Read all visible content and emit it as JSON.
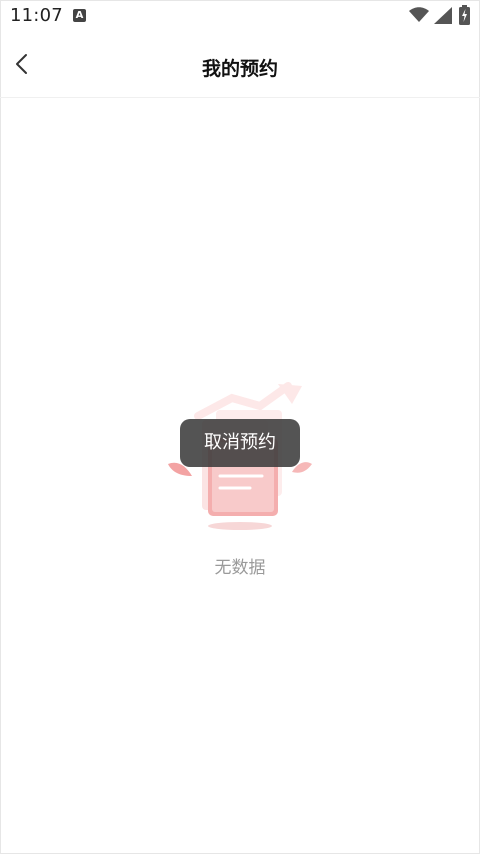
{
  "status_bar": {
    "time": "11:07",
    "notification_icon": "A"
  },
  "header": {
    "title": "我的预约"
  },
  "empty_state": {
    "message": "无数据"
  },
  "toast": {
    "message": "取消预约"
  }
}
